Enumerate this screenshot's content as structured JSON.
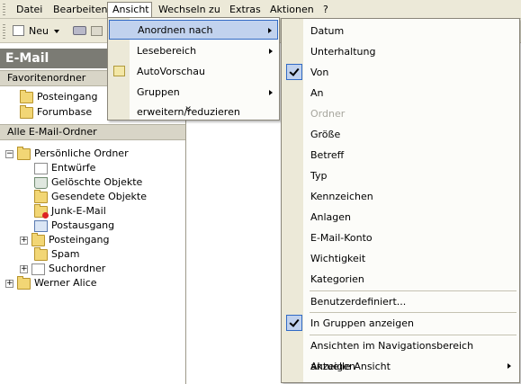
{
  "menubar": {
    "items": [
      {
        "label": "Datei"
      },
      {
        "label": "Bearbeiten"
      },
      {
        "label": "Ansicht"
      },
      {
        "label": "Wechseln zu"
      },
      {
        "label": "Extras"
      },
      {
        "label": "Aktionen"
      },
      {
        "label": "?"
      }
    ]
  },
  "toolbar": {
    "new_label": "Neu"
  },
  "nav": {
    "header": "E-Mail",
    "favorites_title": "Favoritenordner",
    "favorites": [
      {
        "label": "Posteingang"
      },
      {
        "label": "Forumbase"
      }
    ],
    "all_title": "Alle E-Mail-Ordner",
    "tree": [
      {
        "label": "Persönliche Ordner"
      },
      {
        "label": "Entwürfe"
      },
      {
        "label": "Gelöschte Objekte"
      },
      {
        "label": "Gesendete Objekte"
      },
      {
        "label": "Junk-E-Mail"
      },
      {
        "label": "Postausgang"
      },
      {
        "label": "Posteingang"
      },
      {
        "label": "Spam"
      },
      {
        "label": "Suchordner"
      },
      {
        "label": "Werner Alice"
      }
    ]
  },
  "ansicht_menu": {
    "items": [
      {
        "label": "Anordnen nach"
      },
      {
        "label": "Lesebereich"
      },
      {
        "label": "AutoVorschau"
      },
      {
        "label": "Gruppen erweitern/reduzieren"
      }
    ],
    "more": "»"
  },
  "anordnen_menu": {
    "items": [
      {
        "label": "Datum"
      },
      {
        "label": "Unterhaltung"
      },
      {
        "label": "Von",
        "checked": true
      },
      {
        "label": "An"
      },
      {
        "label": "Ordner",
        "disabled": true
      },
      {
        "label": "Größe"
      },
      {
        "label": "Betreff"
      },
      {
        "label": "Typ"
      },
      {
        "label": "Kennzeichen"
      },
      {
        "label": "Anlagen"
      },
      {
        "label": "E-Mail-Konto"
      },
      {
        "label": "Wichtigkeit"
      },
      {
        "label": "Kategorien"
      },
      {
        "label": "Benutzerdefiniert..."
      },
      {
        "label": "In Gruppen anzeigen",
        "checked": true
      },
      {
        "label": "Ansichten im Navigationsbereich anzeigen"
      },
      {
        "label": "Aktuelle Ansicht"
      }
    ]
  },
  "colors": {
    "highlight": "#c1d2ee",
    "highlight_border": "#316ac5",
    "menubar": "#ece9d8"
  }
}
